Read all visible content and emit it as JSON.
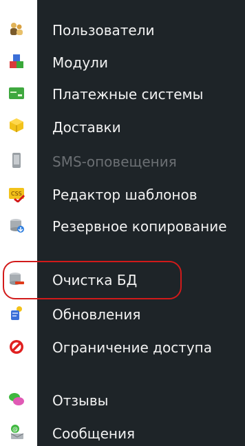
{
  "menu": {
    "items": [
      {
        "label": "Пользователи",
        "icon": "users-icon",
        "enabled": true
      },
      {
        "label": "Модули",
        "icon": "modules-icon",
        "enabled": true
      },
      {
        "label": "Платежные системы",
        "icon": "payment-systems-icon",
        "enabled": true
      },
      {
        "label": "Доставки",
        "icon": "delivery-icon",
        "enabled": true
      },
      {
        "label": "SMS-оповещения",
        "icon": "sms-icon",
        "enabled": false
      },
      {
        "label": "Редактор шаблонов",
        "icon": "css-template-icon",
        "enabled": true
      },
      {
        "label": "Резервное копирование",
        "icon": "backup-icon",
        "enabled": true
      },
      {
        "label": "Очистка БД",
        "icon": "db-clean-icon",
        "enabled": true,
        "highlighted": true
      },
      {
        "label": "Обновления",
        "icon": "updates-icon",
        "enabled": true
      },
      {
        "label": "Ограничение доступа",
        "icon": "access-restriction-icon",
        "enabled": true
      },
      {
        "label": "Отзывы",
        "icon": "reviews-icon",
        "enabled": true
      },
      {
        "label": "Сообщения",
        "icon": "messages-icon",
        "enabled": true
      }
    ]
  },
  "colors": {
    "panel_bg": "#1e2428",
    "text": "#f2f2f2",
    "text_disabled": "#6b6f73",
    "highlight": "#d21a1a"
  }
}
